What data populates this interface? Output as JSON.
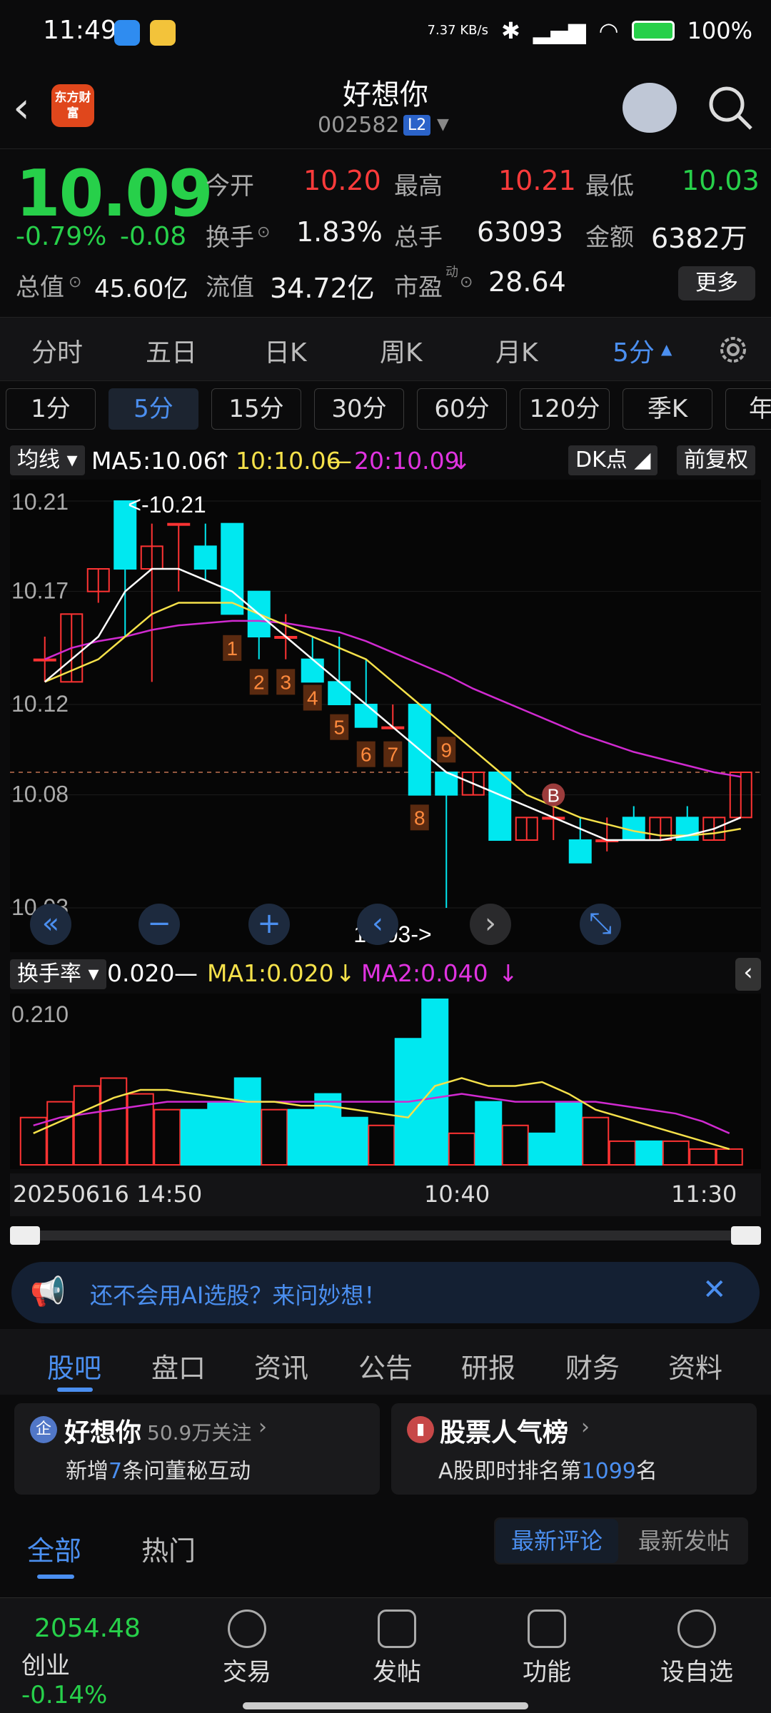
{
  "status": {
    "time": "11:49",
    "net": "7.37 KB/s",
    "battery": "100%"
  },
  "header": {
    "back_label": "‹",
    "logo_text": "东方财富",
    "stock_name": "好想你",
    "stock_code": "002582",
    "level_badge": "L2"
  },
  "quote": {
    "price": "10.09",
    "change_pct": "-0.79%",
    "change_abs": "-0.08",
    "labels": {
      "open": "今开",
      "high": "最高",
      "low": "最低",
      "turnover": "换手",
      "vol": "总手",
      "amount": "金额",
      "total_val": "总值",
      "float_val": "流值",
      "pe": "市盈",
      "pe_sup": "动"
    },
    "values": {
      "open": "10.20",
      "high": "10.21",
      "low": "10.03",
      "turnover": "1.83%",
      "vol": "63093",
      "amount": "6382万",
      "total_val": "45.60亿",
      "float_val": "34.72亿",
      "pe": "28.64"
    },
    "more": "更多"
  },
  "period_tabs": [
    "分时",
    "五日",
    "日K",
    "周K",
    "月K",
    "5分"
  ],
  "minute_tabs": [
    "1分",
    "5分",
    "15分",
    "30分",
    "60分",
    "120分",
    "季K",
    "年"
  ],
  "ma_row": {
    "selector": "均线",
    "ma5": "MA5:10.06",
    "ma10": "10:10.06",
    "ma20": "20:10.09",
    "dk": "DK点",
    "fq": "前复权"
  },
  "chart_data": {
    "type": "candlestick",
    "y_ticks": [
      "10.21",
      "10.17",
      "10.12",
      "10.08",
      "10.03"
    ],
    "ylim": [
      10.03,
      10.21
    ],
    "max_label": "<-10.21",
    "min_label": "10.03->",
    "candles": [
      {
        "o": 10.14,
        "h": 10.15,
        "l": 10.13,
        "c": 10.14
      },
      {
        "o": 10.13,
        "h": 10.16,
        "l": 10.13,
        "c": 10.16
      },
      {
        "o": 10.17,
        "h": 10.18,
        "l": 10.165,
        "c": 10.18
      },
      {
        "o": 10.21,
        "h": 10.21,
        "l": 10.15,
        "c": 10.18
      },
      {
        "o": 10.18,
        "h": 10.2,
        "l": 10.13,
        "c": 10.19
      },
      {
        "o": 10.2,
        "h": 10.2,
        "l": 10.17,
        "c": 10.2
      },
      {
        "o": 10.19,
        "h": 10.2,
        "l": 10.175,
        "c": 10.18
      },
      {
        "o": 10.2,
        "h": 10.2,
        "l": 10.16,
        "c": 10.16
      },
      {
        "o": 10.17,
        "h": 10.17,
        "l": 10.14,
        "c": 10.15
      },
      {
        "o": 10.15,
        "h": 10.16,
        "l": 10.14,
        "c": 10.15
      },
      {
        "o": 10.14,
        "h": 10.15,
        "l": 10.13,
        "c": 10.13
      },
      {
        "o": 10.13,
        "h": 10.15,
        "l": 10.12,
        "c": 10.12
      },
      {
        "o": 10.12,
        "h": 10.14,
        "l": 10.11,
        "c": 10.11
      },
      {
        "o": 10.11,
        "h": 10.12,
        "l": 10.11,
        "c": 10.11
      },
      {
        "o": 10.12,
        "h": 10.12,
        "l": 10.08,
        "c": 10.08
      },
      {
        "o": 10.09,
        "h": 10.09,
        "l": 10.03,
        "c": 10.08
      },
      {
        "o": 10.08,
        "h": 10.09,
        "l": 10.08,
        "c": 10.09
      },
      {
        "o": 10.09,
        "h": 10.09,
        "l": 10.06,
        "c": 10.06
      },
      {
        "o": 10.06,
        "h": 10.07,
        "l": 10.06,
        "c": 10.07
      },
      {
        "o": 10.07,
        "h": 10.08,
        "l": 10.06,
        "c": 10.07
      },
      {
        "o": 10.06,
        "h": 10.07,
        "l": 10.05,
        "c": 10.05
      },
      {
        "o": 10.06,
        "h": 10.07,
        "l": 10.055,
        "c": 10.06
      },
      {
        "o": 10.07,
        "h": 10.075,
        "l": 10.06,
        "c": 10.06
      },
      {
        "o": 10.06,
        "h": 10.07,
        "l": 10.06,
        "c": 10.07
      },
      {
        "o": 10.07,
        "h": 10.075,
        "l": 10.06,
        "c": 10.06
      },
      {
        "o": 10.06,
        "h": 10.07,
        "l": 10.06,
        "c": 10.07
      },
      {
        "o": 10.07,
        "h": 10.09,
        "l": 10.07,
        "c": 10.09
      }
    ],
    "signals": [
      "1",
      "2",
      "3",
      "4",
      "5",
      "6",
      "7",
      "8",
      "9"
    ],
    "b_marker": "B",
    "ma5": [
      10.13,
      10.14,
      10.15,
      10.17,
      10.18,
      10.18,
      10.175,
      10.17,
      10.16,
      10.15,
      10.14,
      10.13,
      10.12,
      10.11,
      10.1,
      10.09,
      10.085,
      10.08,
      10.075,
      10.07,
      10.065,
      10.06,
      10.06,
      10.06,
      10.062,
      10.065,
      10.07
    ],
    "ma10": [
      10.13,
      10.135,
      10.14,
      10.15,
      10.16,
      10.165,
      10.165,
      10.165,
      10.16,
      10.155,
      10.15,
      10.145,
      10.14,
      10.13,
      10.12,
      10.11,
      10.1,
      10.09,
      10.08,
      10.075,
      10.07,
      10.067,
      10.064,
      10.062,
      10.062,
      10.063,
      10.065
    ],
    "ma20": [
      10.14,
      10.145,
      10.148,
      10.15,
      10.153,
      10.155,
      10.156,
      10.157,
      10.157,
      10.156,
      10.154,
      10.152,
      10.148,
      10.143,
      10.138,
      10.133,
      10.127,
      10.122,
      10.117,
      10.112,
      10.107,
      10.103,
      10.099,
      10.096,
      10.093,
      10.09,
      10.088
    ],
    "x_labels": [
      "20250616 14:50",
      "10:40",
      "11:30"
    ],
    "vol_ylabel": "0.210",
    "vol": [
      0.06,
      0.08,
      0.1,
      0.11,
      0.09,
      0.07,
      0.07,
      0.08,
      0.11,
      0.07,
      0.07,
      0.09,
      0.06,
      0.05,
      0.16,
      0.21,
      0.04,
      0.08,
      0.05,
      0.04,
      0.08,
      0.06,
      0.03,
      0.03,
      0.03,
      0.02,
      0.02
    ],
    "vol_up": [
      1,
      1,
      1,
      1,
      1,
      1,
      0,
      0,
      0,
      1,
      0,
      0,
      0,
      1,
      0,
      0,
      1,
      0,
      1,
      0,
      0,
      1,
      1,
      0,
      1,
      1,
      1
    ],
    "vol_ma1": [
      0.04,
      0.055,
      0.07,
      0.085,
      0.095,
      0.095,
      0.09,
      0.085,
      0.08,
      0.08,
      0.075,
      0.075,
      0.07,
      0.065,
      0.06,
      0.1,
      0.11,
      0.1,
      0.1,
      0.105,
      0.09,
      0.07,
      0.06,
      0.05,
      0.04,
      0.03,
      0.02
    ],
    "vol_ma2": [
      0.05,
      0.06,
      0.065,
      0.07,
      0.075,
      0.08,
      0.08,
      0.08,
      0.08,
      0.08,
      0.08,
      0.08,
      0.08,
      0.08,
      0.08,
      0.085,
      0.09,
      0.085,
      0.08,
      0.08,
      0.08,
      0.08,
      0.075,
      0.07,
      0.065,
      0.055,
      0.04
    ],
    "vol_legend": {
      "selector": "换手率",
      "val": "0.020",
      "ma1": "MA1:0.020",
      "ma2": "MA2:0.040"
    }
  },
  "banner": {
    "text": "还不会用AI选股？来问妙想！"
  },
  "bottom_tabs": [
    "股吧",
    "盘口",
    "资讯",
    "公告",
    "研报",
    "财务",
    "资料"
  ],
  "cards": {
    "left_title": "好想你",
    "left_follow": "50.9万关注",
    "left_pre": "新增",
    "left_num": "7",
    "left_post": "条问董秘互动",
    "right_title": "股票人气榜",
    "right_pre": "A股即时排名第",
    "right_num": "1099",
    "right_post": "名"
  },
  "sub_tabs": {
    "all": "全部",
    "hot": "热门",
    "latest_comment": "最新评论",
    "latest_post": "最新发帖"
  },
  "bottom_nav": {
    "index_value": "2054.48",
    "index_name": "创业",
    "index_change": "-0.14%",
    "items": [
      "交易",
      "发帖",
      "功能",
      "设自选"
    ]
  }
}
